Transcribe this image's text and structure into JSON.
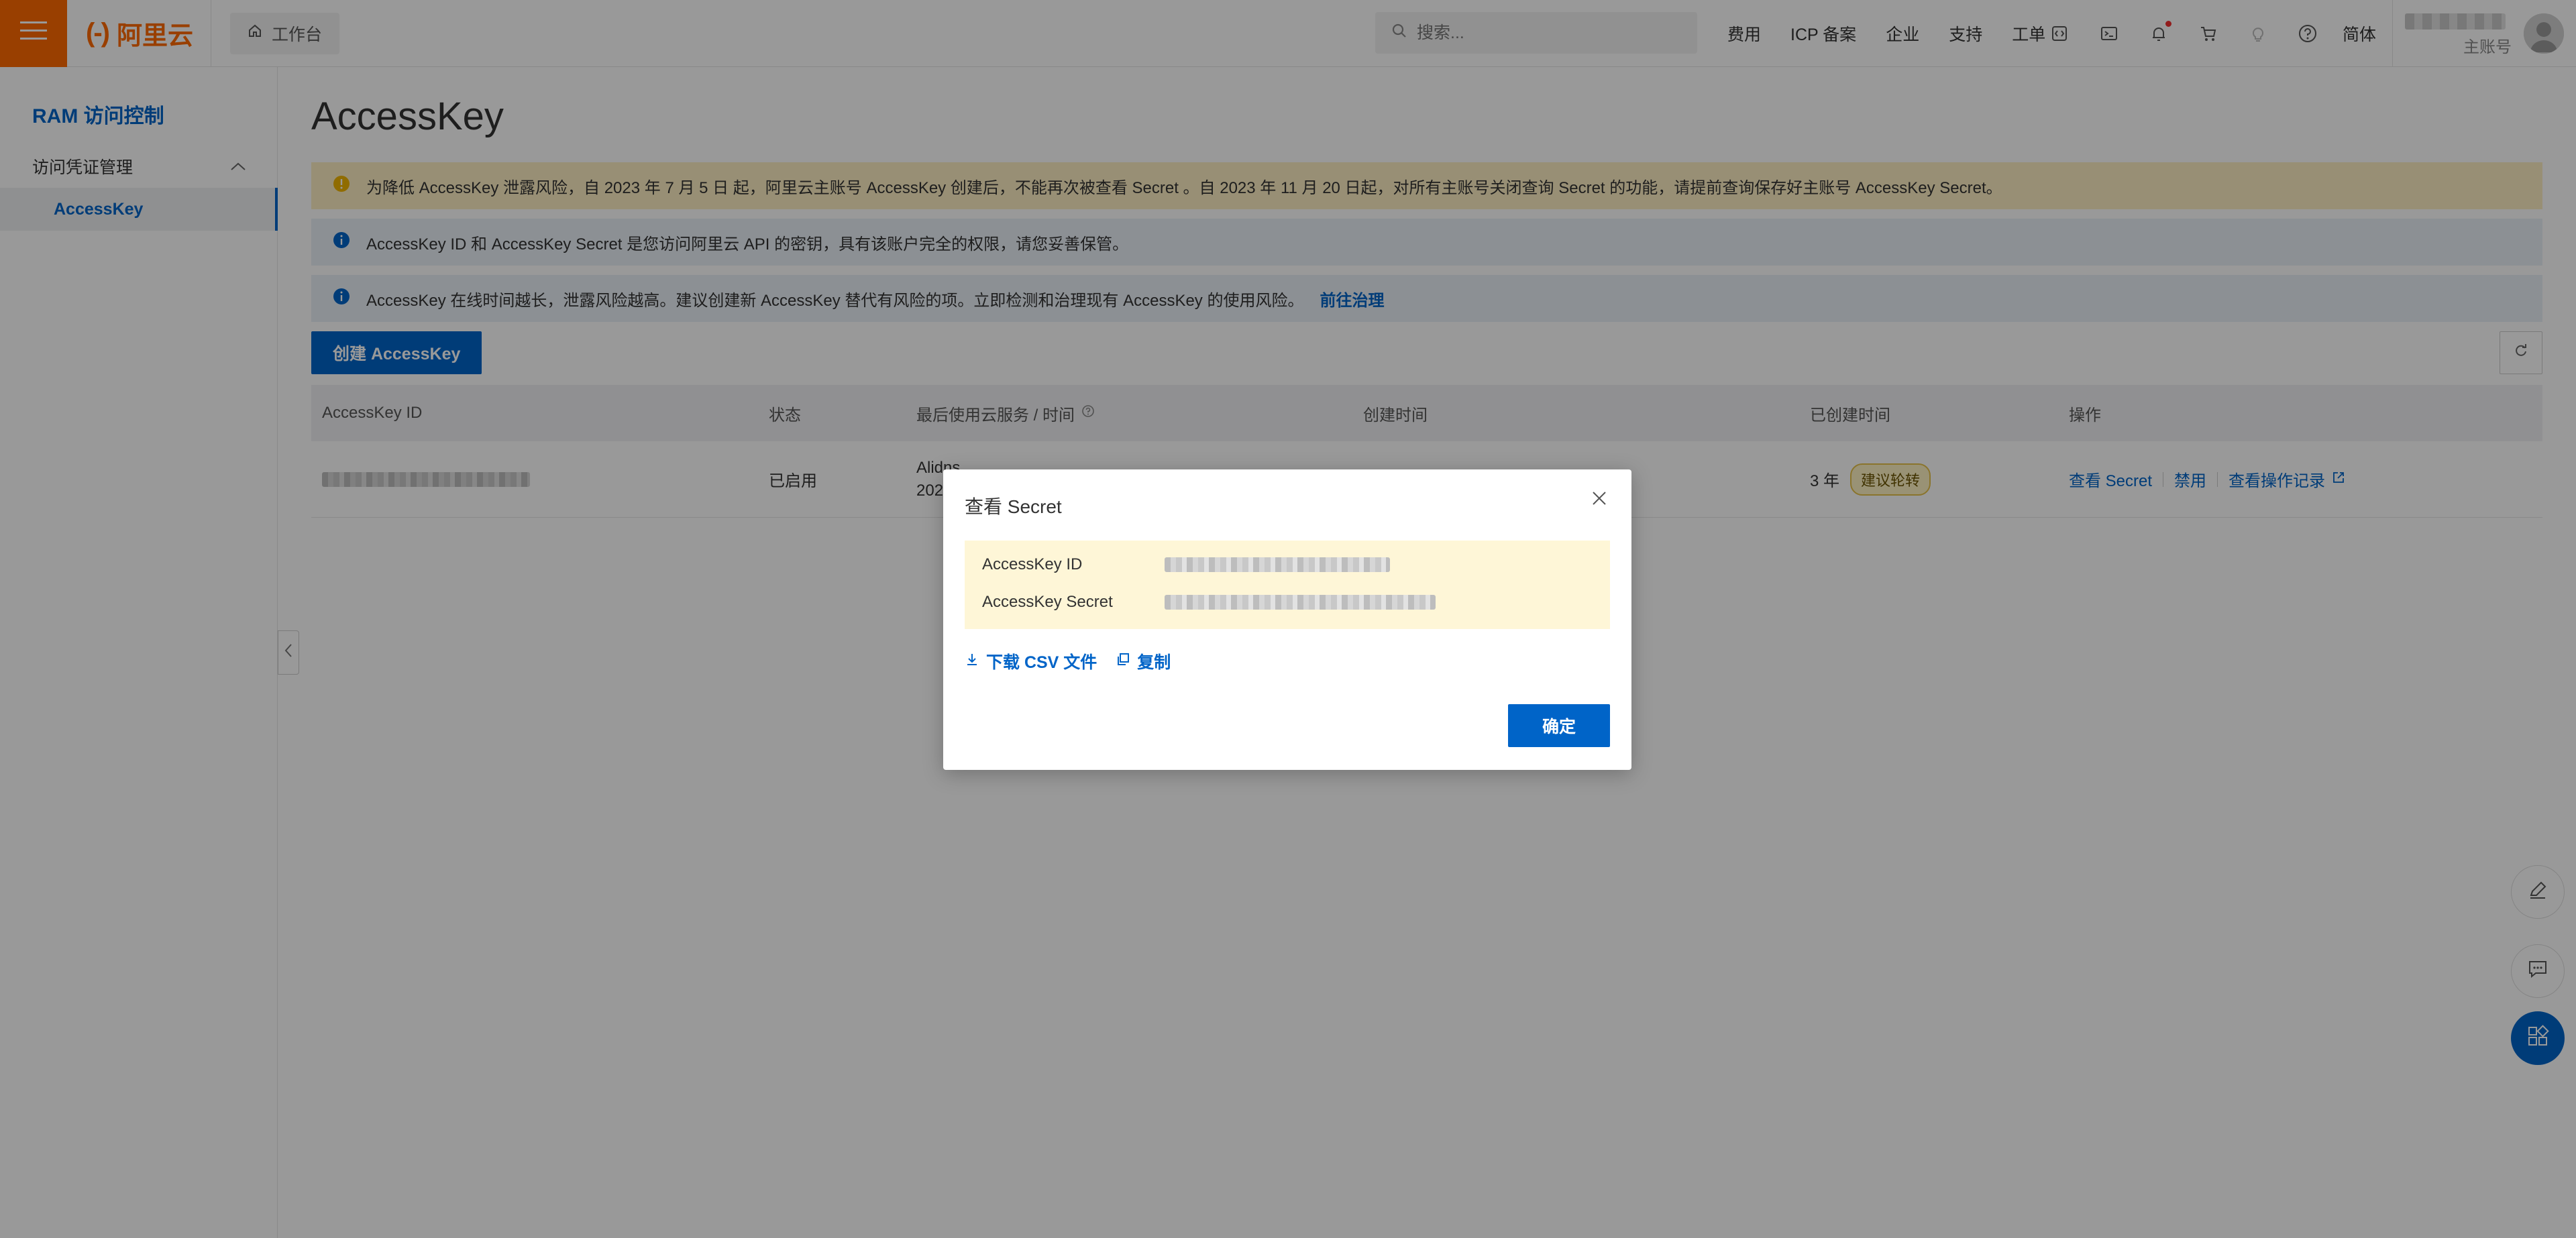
{
  "topbar": {
    "workbench_label": "工作台",
    "search_placeholder": "搜索...",
    "nav": [
      "费用",
      "ICP 备案",
      "企业",
      "支持",
      "工单"
    ],
    "language": "简体",
    "account_type": "主账号",
    "logo_text": "阿里云",
    "icons": [
      "menu-icon",
      "home-icon",
      "search-icon",
      "code-icon",
      "terminal-icon",
      "bell-icon",
      "cart-icon",
      "bulb-icon",
      "help-icon"
    ]
  },
  "sidebar": {
    "title": "RAM 访问控制",
    "group_label": "访问凭证管理",
    "active_item": "AccessKey"
  },
  "main": {
    "page_title": "AccessKey",
    "notices": [
      "为降低 AccessKey 泄露风险，自 2023 年 7 月 5 日 起，阿里云主账号 AccessKey 创建后，不能再次被查看 Secret 。自 2023 年 11 月 20 日起，对所有主账号关闭查询 Secret 的功能，请提前查询保存好主账号 AccessKey Secret。",
      "AccessKey ID 和 AccessKey Secret 是您访问阿里云 API 的密钥，具有该账户完全的权限，请您妥善保管。",
      "AccessKey 在线时间越长，泄露风险越高。建议创建新 AccessKey 替代有风险的项。立即检测和治理现有 AccessKey 的使用风险。"
    ],
    "notice_link": "前往治理",
    "create_button": "创建 AccessKey",
    "table": {
      "headers": [
        "AccessKey ID",
        "状态",
        "最后使用云服务 / 时间",
        "创建时间",
        "已创建时间",
        "操作"
      ],
      "rows": [
        {
          "status": "已启用",
          "last_used_line1": "Alidns",
          "last_used_line2": "202",
          "age": "3 年",
          "badge": "建议轮转",
          "actions": [
            "查看 Secret",
            "禁用",
            "查看操作记录"
          ]
        }
      ]
    }
  },
  "modal": {
    "title": "查看 Secret",
    "id_label": "AccessKey ID",
    "secret_label": "AccessKey Secret",
    "download_label": "下载 CSV 文件",
    "copy_label": "复制",
    "confirm_label": "确定"
  },
  "colors": {
    "brand_orange": "#ff6a00",
    "primary_blue": "#0064c8",
    "warning_bg": "#fdefc3",
    "info_bg": "#eaf0f7"
  }
}
